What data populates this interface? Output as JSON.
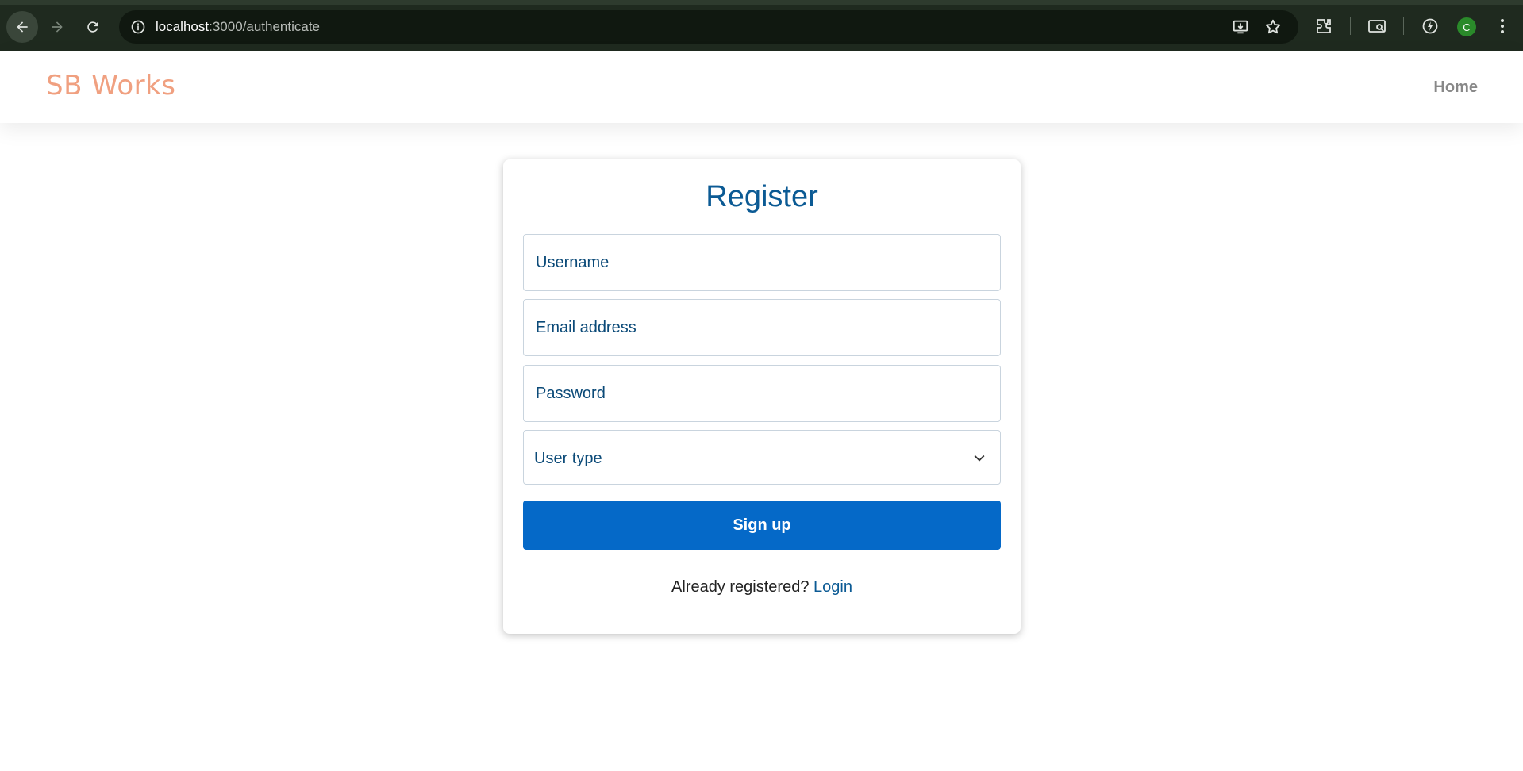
{
  "browser": {
    "url_host": "localhost",
    "url_path": ":3000/authenticate",
    "profile_initial": "C"
  },
  "navbar": {
    "brand": "SB Works",
    "home_label": "Home"
  },
  "register": {
    "title": "Register",
    "username_placeholder": "Username",
    "email_placeholder": "Email address",
    "password_placeholder": "Password",
    "user_type_value": "User type",
    "signup_label": "Sign up",
    "already_text": "Already registered?",
    "login_label": "Login"
  },
  "colors": {
    "brand": "#f0a080",
    "title": "#0b5a94",
    "primary_button": "#0569c8",
    "chrome_bg": "#1f2a1f"
  },
  "icons": [
    "back-arrow-icon",
    "forward-arrow-icon",
    "reload-icon",
    "info-icon",
    "install-icon",
    "star-icon",
    "extensions-icon",
    "tab-search-icon",
    "performance-icon",
    "more-vert-icon",
    "chevron-down-icon"
  ]
}
